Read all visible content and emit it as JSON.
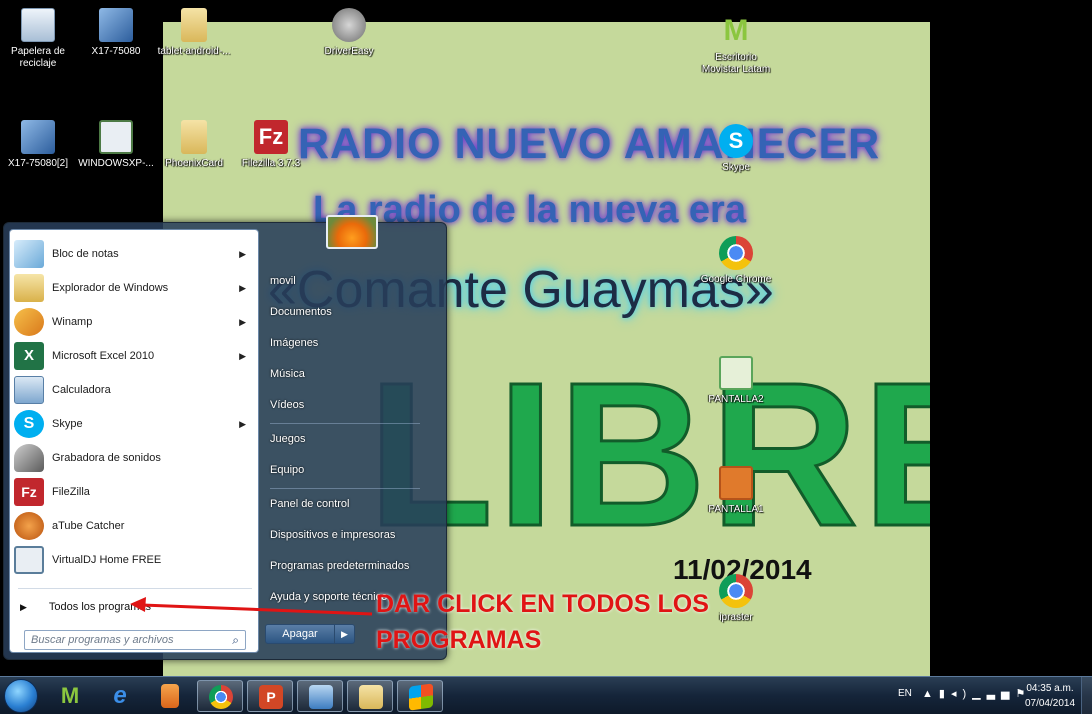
{
  "wallpaper": {
    "line1": "RADIO NUEVO AMANECER",
    "line2": "La radio de la nueva era",
    "line3": "«Comante Guaymas»",
    "big": "LIBRE",
    "date": "11/02/2014"
  },
  "desktop_icons": [
    {
      "label": "Papelera de reciclaje",
      "icon": "recycle-bin-icon",
      "color": "#c9d9ea"
    },
    {
      "label": "X17-75080",
      "icon": "setup-icon",
      "color": "#4a7fc1"
    },
    {
      "label": "tablet-android-...",
      "icon": "folder-icon",
      "color": "#e8cf82"
    },
    {
      "label": "DriverEasy",
      "icon": "drivereasy-icon",
      "color": "#8c8c8c"
    },
    {
      "label": "Escritorio Movistar Latam",
      "icon": "movistar-icon",
      "color": "#8bc63f"
    },
    {
      "label": "X17-75080[2]",
      "icon": "setup-icon",
      "color": "#4a7fc1"
    },
    {
      "label": "WINDOWSXP-...",
      "icon": "document-icon",
      "color": "#e9eef3"
    },
    {
      "label": "PhoenixCard",
      "icon": "folder-icon",
      "color": "#e8cf82"
    },
    {
      "label": "Filezilla 3.7.3",
      "icon": "filezilla-icon",
      "color": "#c1272d"
    },
    {
      "label": "Skype",
      "icon": "skype-icon",
      "color": "#00aff0"
    },
    {
      "label": "Google Chrome",
      "icon": "chrome-icon",
      "color": "#e0443a"
    },
    {
      "label": "PANTALLA2",
      "icon": "image-icon",
      "color": "#5aa55a"
    },
    {
      "label": "PANTALLA1",
      "icon": "image-icon",
      "color": "#e07a2c"
    },
    {
      "label": "ipraster",
      "icon": "chrome-icon",
      "color": "#e0443a"
    }
  ],
  "start_menu": {
    "programs": [
      {
        "label": "Bloc de notas",
        "icon": "notepad-icon",
        "color": "#6aa9d8",
        "arrow": "▶"
      },
      {
        "label": "Explorador de Windows",
        "icon": "explorer-icon",
        "color": "#e6c45a",
        "arrow": "▶"
      },
      {
        "label": "Winamp",
        "icon": "winamp-icon",
        "color": "#e98f1b",
        "arrow": "▶"
      },
      {
        "label": "Microsoft Excel 2010",
        "icon": "excel-icon",
        "color": "#217346",
        "arrow": "▶"
      },
      {
        "label": "Calculadora",
        "icon": "calculator-icon",
        "color": "#7ea7cf",
        "arrow": ""
      },
      {
        "label": "Skype",
        "icon": "skype-icon",
        "color": "#00aff0",
        "arrow": "▶"
      },
      {
        "label": "Grabadora de sonidos",
        "icon": "microphone-icon",
        "color": "#6f6f6f",
        "arrow": ""
      },
      {
        "label": "FileZilla",
        "icon": "filezilla-icon",
        "color": "#c1272d",
        "arrow": ""
      },
      {
        "label": "aTube Catcher",
        "icon": "atube-icon",
        "color": "#d96a1c",
        "arrow": ""
      },
      {
        "label": "VirtualDJ Home FREE",
        "icon": "virtualdj-icon",
        "color": "#5a7d9a",
        "arrow": ""
      }
    ],
    "all_programs": "Todos los programas",
    "search_placeholder": "Buscar programas y archivos",
    "right_items": [
      "movil",
      "Documentos",
      "Imágenes",
      "Música",
      "Vídeos",
      "Juegos",
      "Equipo",
      "Panel de control",
      "Dispositivos e impresoras",
      "Programas predeterminados",
      "Ayuda y soporte técnico"
    ],
    "shutdown": "Apagar"
  },
  "annotation": {
    "text": "DAR CLICK EN TODOS LOS PROGRAMAS",
    "color": "#e01414"
  },
  "taskbar": {
    "pinned": [
      {
        "icon": "movistar-icon",
        "color": "#8bc63f",
        "active": false
      },
      {
        "icon": "internet-explorer-icon",
        "color": "#2f7fd6",
        "active": false
      },
      {
        "icon": "media-player-icon",
        "color": "#e87722",
        "active": false
      },
      {
        "icon": "chrome-icon",
        "color": "#e0443a",
        "active": true
      },
      {
        "icon": "powerpoint-icon",
        "color": "#d24726",
        "active": true
      },
      {
        "icon": "network-icon",
        "color": "#5a9ad6",
        "active": true
      },
      {
        "icon": "folder-icon",
        "color": "#e8cf82",
        "active": true
      },
      {
        "icon": "windows-icon",
        "color": "#3a8be0",
        "active": true
      }
    ],
    "language": "EN",
    "time": "04:35 a.m.",
    "date": "07/04/2014"
  }
}
